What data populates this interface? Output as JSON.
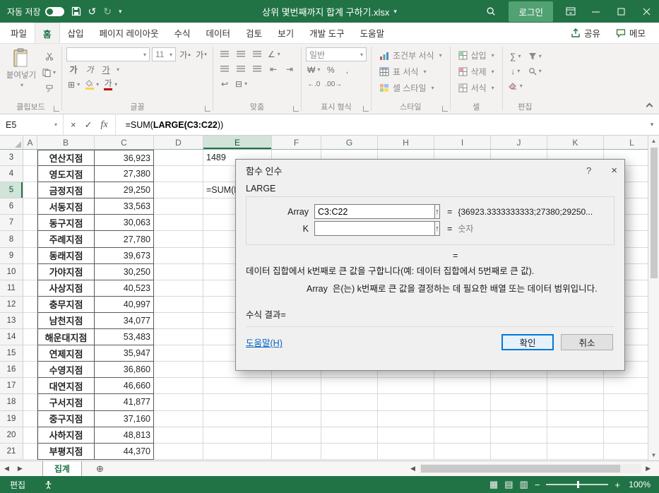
{
  "colors": {
    "titlebar_green": "#217346",
    "selection_green": "#d2e3da",
    "login_green": "#52a173",
    "link_blue": "#0563c1",
    "focus_blue": "#0078d7"
  },
  "icons": {
    "dropdown": "▾",
    "undo": "↺",
    "redo": "↻",
    "sum": "∑",
    "borders": "⊞",
    "merge": "⊟",
    "wrap": "↩",
    "orientation": "∠",
    "indent_left": "⇤",
    "indent_right": "⇥",
    "currency": "₩",
    "percent": "%",
    "comma": ",",
    "dec_decrease": "←.0",
    "dec_increase": ".00→",
    "fill_down": "↓",
    "range_select": "↑",
    "prev_sheet": "◀",
    "next_sheet": "▶",
    "scroll_up": "▲",
    "scroll_down": "▼",
    "scroll_left": "◀",
    "scroll_right": "▶",
    "new_sheet": "⊕",
    "view_normal": "▦",
    "view_layout": "▤",
    "view_break": "▥",
    "zoom_minus": "−",
    "zoom_plus": "+",
    "fx": "fx",
    "cancel_entry": "×",
    "confirm_entry": "✓",
    "help": "?",
    "close": "×",
    "font_increase": "가",
    "font_decrease": "가",
    "bold": "가",
    "italic": "가",
    "underline": "가",
    "font_color": "가"
  },
  "titlebar": {
    "autosave_label": "자동 저장",
    "title": "상위 몇번째까지 합계 구하기.xlsx",
    "login_label": "로그인"
  },
  "ribbon_tabs": [
    "파일",
    "홈",
    "삽입",
    "페이지 레이아웃",
    "수식",
    "데이터",
    "검토",
    "보기",
    "개발 도구",
    "도움말"
  ],
  "ribbon_actions": {
    "share": "공유",
    "comments": "메모"
  },
  "ribbon": {
    "groups": [
      "클립보드",
      "글꼴",
      "맞춤",
      "표시 형식",
      "스타일",
      "셀",
      "편집"
    ],
    "paste_label": "붙여넣기",
    "font_name": "",
    "font_size": "11",
    "number_format": "일반",
    "style_buttons": [
      "조건부 서식",
      "표 서식",
      "셀 스타일"
    ],
    "cell_buttons": [
      "삽입",
      "삭제",
      "서식"
    ]
  },
  "formula_bar": {
    "name_box": "E5",
    "formula_prefix": "=SUM(",
    "formula_bold": "LARGE(C3:C22",
    "formula_suffix": "))"
  },
  "grid": {
    "columns": [
      "A",
      "B",
      "C",
      "D",
      "E",
      "F",
      "G",
      "H",
      "I",
      "J",
      "K",
      "L"
    ],
    "selected_column": "E",
    "selected_row": 5,
    "rows": [
      {
        "n": 3,
        "b": "연산지점",
        "c": "36,923",
        "e": "1489"
      },
      {
        "n": 4,
        "b": "영도지점",
        "c": "27,380"
      },
      {
        "n": 5,
        "b": "금정지점",
        "c": "29,250",
        "e": "=SUM(LARGE(C3:C22))"
      },
      {
        "n": 6,
        "b": "서동지점",
        "c": "33,563"
      },
      {
        "n": 7,
        "b": "동구지점",
        "c": "30,063"
      },
      {
        "n": 8,
        "b": "주례지점",
        "c": "27,780"
      },
      {
        "n": 9,
        "b": "동래지점",
        "c": "39,673"
      },
      {
        "n": 10,
        "b": "가야지점",
        "c": "30,250"
      },
      {
        "n": 11,
        "b": "사상지점",
        "c": "40,523"
      },
      {
        "n": 12,
        "b": "충무지점",
        "c": "40,997"
      },
      {
        "n": 13,
        "b": "남천지점",
        "c": "34,077"
      },
      {
        "n": 14,
        "b": "해운대지점",
        "c": "53,483"
      },
      {
        "n": 15,
        "b": "연제지점",
        "c": "35,947"
      },
      {
        "n": 16,
        "b": "수영지점",
        "c": "36,860"
      },
      {
        "n": 17,
        "b": "대연지점",
        "c": "46,660"
      },
      {
        "n": 18,
        "b": "구서지점",
        "c": "41,877"
      },
      {
        "n": 19,
        "b": "중구지점",
        "c": "37,160"
      },
      {
        "n": 20,
        "b": "사하지점",
        "c": "48,813"
      },
      {
        "n": 21,
        "b": "부평지점",
        "c": "44,370"
      }
    ]
  },
  "dialog": {
    "title": "함수 인수",
    "function_name": "LARGE",
    "eq": "=",
    "fields": [
      {
        "label": "Array",
        "value": "C3:C22",
        "result": "{36923.3333333333;27380;29250..."
      },
      {
        "label": "K",
        "value": "",
        "result": "숫자"
      }
    ],
    "description": "데이터 집합에서 k번째로 큰 값을 구합니다(예: 데이터 집합에서 5번째로 큰 값).",
    "param_name": "Array",
    "param_desc": "은(는) k번째로 큰 값을 결정하는 데 필요한 배열 또는 데이터 범위입니다.",
    "result_label": "수식 결과=",
    "help_link": "도움말(H)",
    "ok_label": "확인",
    "cancel_label": "취소"
  },
  "sheet_tabs": {
    "active": "집계"
  },
  "status_bar": {
    "mode": "편집",
    "zoom": "100%"
  }
}
